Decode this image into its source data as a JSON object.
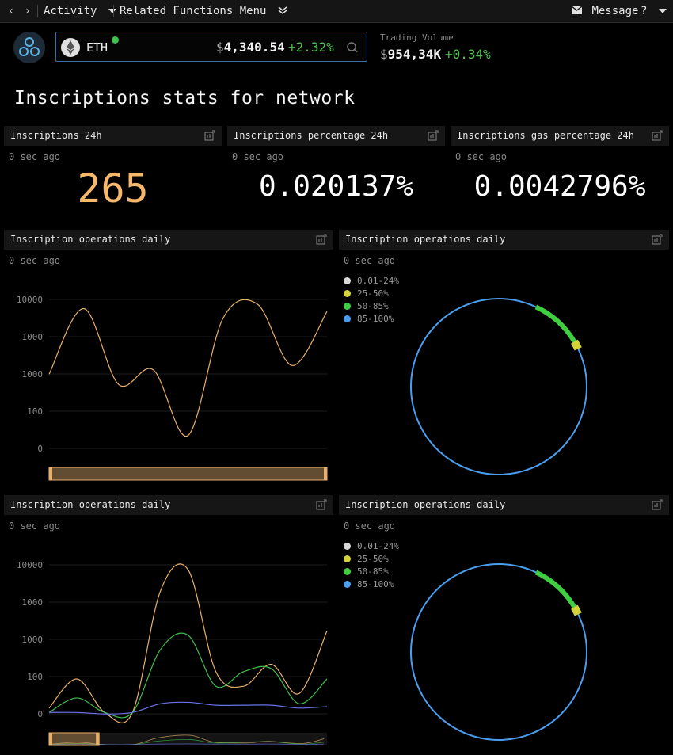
{
  "topbar": {
    "back_glyph": "‹",
    "forward_glyph": "›",
    "activity_label": "Activity",
    "related_label": "Related Functions Menu",
    "message_label": "Message",
    "help_label": "?"
  },
  "ticker": {
    "coin": "ETH",
    "currency_symbol": "$",
    "price": "4,340.54",
    "change": "+2.32%",
    "volume_label": "Trading Volume",
    "volume_value": "954,34K",
    "volume_change": "+0.34%"
  },
  "page_title": "Inscriptions stats for network",
  "stat_cards": [
    {
      "title": "Inscriptions 24h",
      "ago": "0 sec ago",
      "value": "265",
      "color": "#f6b86a"
    },
    {
      "title": "Inscriptions percentage 24h",
      "ago": "0 sec ago",
      "value": "0.020137%",
      "color": "#ffffff"
    },
    {
      "title": "Inscriptions gas percentage 24h",
      "ago": "0 sec ago",
      "value": "0.0042796%",
      "color": "#ffffff"
    }
  ],
  "panels": [
    {
      "title": "Inscription operations daily",
      "ago": "0 sec ago"
    },
    {
      "title": "Inscription operations daily",
      "ago": "0 sec ago"
    },
    {
      "title": "Inscription operations daily",
      "ago": "0 sec ago"
    },
    {
      "title": "Inscription operations daily",
      "ago": "0 sec ago"
    }
  ],
  "legend": [
    {
      "label": "0.01-24%",
      "color": "#d9d9d9"
    },
    {
      "label": "25-50%",
      "color": "#d4d43a"
    },
    {
      "label": "50-85%",
      "color": "#3fce3f"
    },
    {
      "label": "85-100%",
      "color": "#4a9ef0"
    }
  ],
  "colors": {
    "accent_blue": "#3a6ea5",
    "positive": "#4ec24e",
    "orange": "#f6b86a"
  },
  "icons": [
    "back-icon",
    "forward-icon",
    "chevron-down-icon",
    "double-chevron-icon",
    "mail-icon",
    "help-icon",
    "app-logo-icon",
    "eth-icon",
    "verified-icon",
    "search-icon",
    "export-icon"
  ],
  "chart_data": [
    {
      "type": "line",
      "y_ticks": [
        "10000",
        "1000",
        "1000",
        "100",
        "0"
      ],
      "series": [
        {
          "color": "#e8b06a",
          "values": [
            0.52,
            0.97,
            0.45,
            0.55,
            0.1,
            0.9,
            1.0,
            0.58,
            0.95
          ]
        }
      ]
    },
    {
      "type": "pie",
      "labels": [
        "0.01-24%",
        "25-50%",
        "50-85%",
        "85-100%"
      ],
      "values": [
        0,
        1.5,
        9.5,
        89
      ]
    },
    {
      "type": "line",
      "y_ticks": [
        "10000",
        "1000",
        "1000",
        "100",
        "0"
      ],
      "series": [
        {
          "color": "#e8b06a",
          "values": [
            0.05,
            0.25,
            0.02,
            0.02,
            0.85,
            1.0,
            0.3,
            0.2,
            0.35,
            0.15,
            0.58
          ]
        },
        {
          "color": "#3fbf4e",
          "values": [
            0.02,
            0.12,
            0.02,
            0.02,
            0.45,
            0.55,
            0.2,
            0.3,
            0.32,
            0.08,
            0.25
          ]
        },
        {
          "color": "#6a74e8",
          "values": [
            0.02,
            0.02,
            0.01,
            0.02,
            0.08,
            0.09,
            0.07,
            0.07,
            0.07,
            0.05,
            0.06
          ]
        }
      ]
    },
    {
      "type": "pie",
      "labels": [
        "0.01-24%",
        "25-50%",
        "50-85%",
        "85-100%"
      ],
      "values": [
        0,
        1.5,
        9.5,
        89
      ]
    }
  ]
}
